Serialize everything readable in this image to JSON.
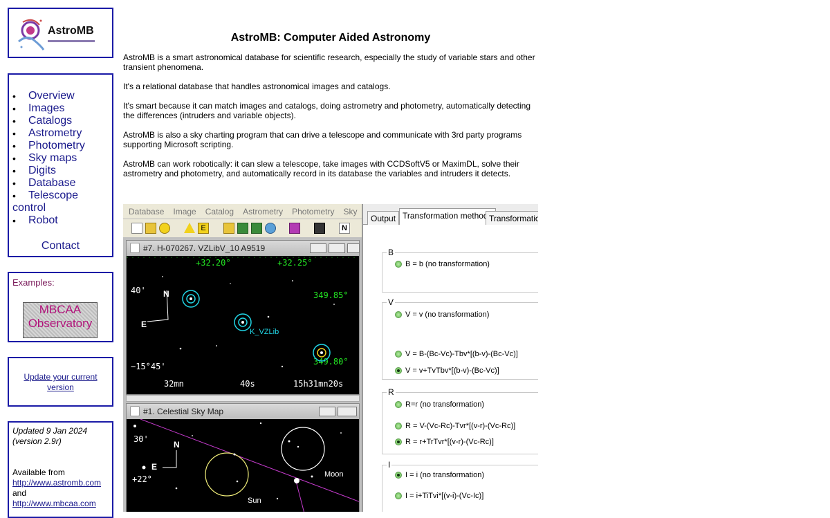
{
  "logo": {
    "text": "AstroMB"
  },
  "nav": {
    "items": [
      {
        "label": "Overview"
      },
      {
        "label": "Images"
      },
      {
        "label": "Catalogs"
      },
      {
        "label": "Astrometry"
      },
      {
        "label": "Photometry"
      },
      {
        "label": "Sky maps"
      },
      {
        "label": "Digits"
      },
      {
        "label": "Database"
      },
      {
        "label_line1": "Telescope",
        "label_line2": "control"
      },
      {
        "label": "Robot"
      }
    ],
    "contact": "Contact"
  },
  "examples": {
    "label": "Examples:",
    "mbcaa_line1": "MBCAA",
    "mbcaa_line2": "Observatory"
  },
  "update": {
    "line1": "Update your current",
    "line2": "version"
  },
  "info": {
    "updated": "Updated 9 Jan 2024",
    "version": "(version 2.9r)",
    "available": "Available from",
    "url1": "http://www.astromb.com",
    "and": "and",
    "url2": "http://www.mbcaa.com"
  },
  "main": {
    "title": "AstroMB: Computer Aided Astronomy",
    "paragraphs": [
      "AstroMB is a smart astronomical database for scientific research, especially the study of variable stars and other transient phenomena.",
      "It's a relational database that handles astronomical images and catalogs.",
      "It's smart because it can match images and catalogs, doing astrometry and photometry, automatically detecting the differences (intruders and variable objects).",
      "AstroMB is also a sky charting program that can drive a telescope and communicate with 3rd party programs supporting Microsoft scripting.",
      "AstroMB can work robotically: it can slew a telescope, take images with CCDSoftV5 or MaximDL, solve their astrometry and photometry, and automatically record in its database the variables and intruders it detects."
    ]
  },
  "screenshot": {
    "menu": [
      "Database",
      "Image",
      "Catalog",
      "Astrometry",
      "Photometry",
      "Sky"
    ],
    "win1_title": "#7. H-070267. VZLibV_10 A9519",
    "win1_labels": {
      "ra1": "+32.20°",
      "ra2": "+32.25°",
      "dec1": "349.85°",
      "dec2": "349.80°",
      "d40": "40'",
      "dneg": "−15°45'",
      "n": "N",
      "e": "E",
      "star": "K_VZLib",
      "t1": "32mn",
      "t2": "40s",
      "t3": "15h31mn20s"
    },
    "win2_title": "#1. Celestial Sky Map",
    "win2_labels": {
      "d30": "30'",
      "d22": "+22°",
      "n": "N",
      "e": "E",
      "sun": "Sun",
      "moon": "Moon"
    },
    "tabs": [
      "Output",
      "Transformation methods",
      "Transformation"
    ],
    "groups": [
      {
        "label": "B",
        "options": [
          "B = b (no transformation)"
        ]
      },
      {
        "label": "V",
        "options": [
          "V = v (no transformation)",
          "V = B-(Bc-Vc)-Tbv*[(b-v)-(Bc-Vc)]",
          "V = v+TvTbv*[(b-v)-(Bc-Vc)]"
        ]
      },
      {
        "label": "R",
        "options": [
          "R=r (no transformation)",
          "R = V-(Vc-Rc)-Tvr*[(v-r)-(Vc-Rc)]",
          "R = r+TrTvr*[(v-r)-(Vc-Rc)]"
        ]
      },
      {
        "label": "I",
        "options": [
          "I = i (no transformation)",
          "I = i+TiTvi*[(v-i)-(Vc-Ic)]"
        ]
      }
    ]
  }
}
